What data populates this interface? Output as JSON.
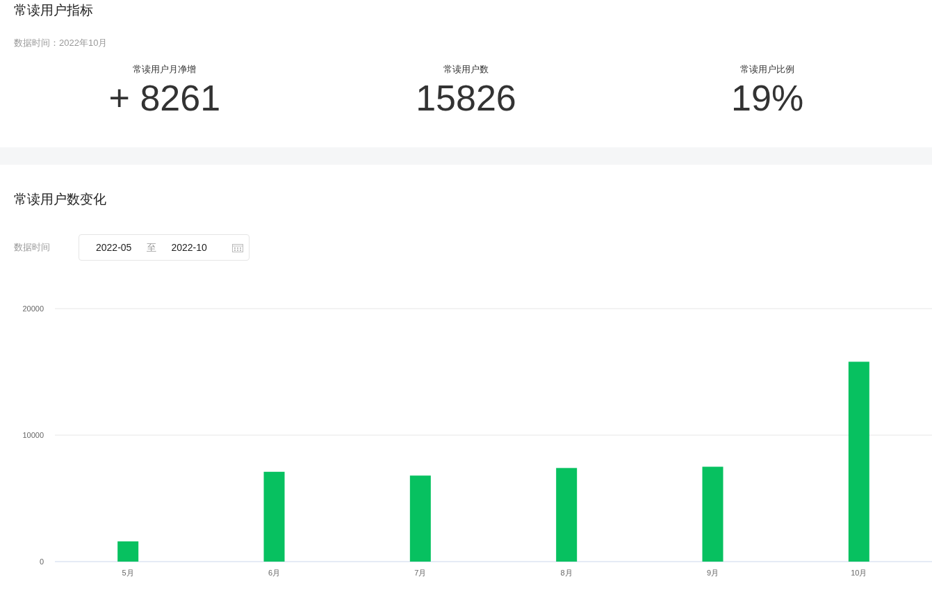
{
  "metrics_section": {
    "title": "常读用户指标",
    "data_time": "数据时间：2022年10月",
    "metrics": [
      {
        "label": "常读用户月净增",
        "value": "+ 8261"
      },
      {
        "label": "常读用户数",
        "value": "15826"
      },
      {
        "label": "常读用户比例",
        "value": "19%"
      }
    ]
  },
  "trend_section": {
    "title": "常读用户数变化",
    "filter_label": "数据时间",
    "start_date": "2022-05",
    "separator": "至",
    "end_date": "2022-10",
    "chart_data": {
      "type": "bar",
      "categories": [
        "5月",
        "6月",
        "7月",
        "8月",
        "9月",
        "10月"
      ],
      "series": [
        {
          "color": "#07c160",
          "values": [
            1600,
            7100,
            6800,
            7400,
            7500,
            15800
          ]
        }
      ],
      "ylim": [
        0,
        20000
      ],
      "yticks": [
        0,
        10000,
        20000
      ]
    }
  }
}
